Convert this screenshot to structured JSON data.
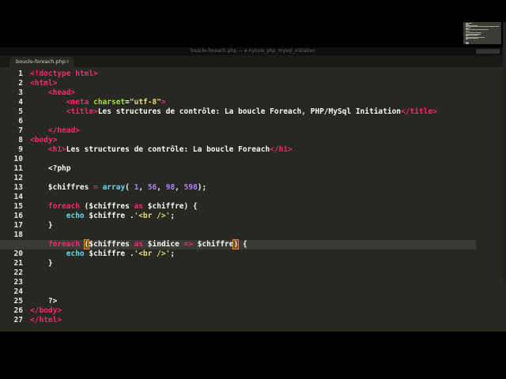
{
  "window_title": "boucle-foreach.php — e-nyture_php_mysql_initiation",
  "tab": {
    "label": "boucle-foreach.php",
    "close": "×"
  },
  "current_line": 19,
  "lines": [
    [
      {
        "t": "<!doctype html>",
        "c": "tg"
      }
    ],
    [
      {
        "t": "<html>",
        "c": "tg"
      }
    ],
    [
      {
        "t": "    "
      },
      {
        "t": "<head>",
        "c": "tg"
      }
    ],
    [
      {
        "t": "        "
      },
      {
        "t": "<meta ",
        "c": "tg"
      },
      {
        "t": "charset",
        "c": "at"
      },
      {
        "t": "="
      },
      {
        "t": "\"utf-8\"",
        "c": "st"
      },
      {
        "t": ">",
        "c": "tg"
      }
    ],
    [
      {
        "t": "        "
      },
      {
        "t": "<title>",
        "c": "tg"
      },
      {
        "t": "Les structures de contrôle: La boucle Foreach, PHP/MySql Initiation"
      },
      {
        "t": "</title>",
        "c": "tg"
      }
    ],
    [],
    [
      {
        "t": "    "
      },
      {
        "t": "</head>",
        "c": "tg"
      }
    ],
    [
      {
        "t": "<body>",
        "c": "tg"
      }
    ],
    [
      {
        "t": "    "
      },
      {
        "t": "<h1>",
        "c": "tg"
      },
      {
        "t": "Les structures de contrôle: La boucle Foreach"
      },
      {
        "t": "</h1>",
        "c": "tg"
      }
    ],
    [],
    [
      {
        "t": "    "
      },
      {
        "t": "<?php"
      }
    ],
    [],
    [
      {
        "t": "    "
      },
      {
        "t": "$chiffres ",
        "c": "vr"
      },
      {
        "t": "=",
        "c": "kw"
      },
      {
        "t": " "
      },
      {
        "t": "array",
        "c": "fn"
      },
      {
        "t": "( "
      },
      {
        "t": "1",
        "c": "nm"
      },
      {
        "t": ", "
      },
      {
        "t": "56",
        "c": "nm"
      },
      {
        "t": ", "
      },
      {
        "t": "98",
        "c": "nm"
      },
      {
        "t": ", "
      },
      {
        "t": "598",
        "c": "nm"
      },
      {
        "t": ");"
      }
    ],
    [],
    [
      {
        "t": "    "
      },
      {
        "t": "foreach",
        "c": "kw"
      },
      {
        "t": " ($chiffres "
      },
      {
        "t": "as",
        "c": "kw"
      },
      {
        "t": " $chiffre) {"
      }
    ],
    [
      {
        "t": "        "
      },
      {
        "t": "echo",
        "c": "fn"
      },
      {
        "t": " $chiffre ."
      },
      {
        "t": "'<br />'",
        "c": "st"
      },
      {
        "t": ";"
      }
    ],
    [
      {
        "t": "    }"
      }
    ],
    [],
    [
      {
        "t": "    "
      },
      {
        "t": "foreach",
        "c": "kw"
      },
      {
        "t": " "
      },
      {
        "t": "(",
        "c": "brk"
      },
      {
        "t": "$chiffres "
      },
      {
        "t": "as",
        "c": "kw"
      },
      {
        "t": " $indice "
      },
      {
        "t": "=>",
        "c": "kw"
      },
      {
        "t": " $chiffre"
      },
      {
        "t": ")",
        "c": "brk"
      },
      {
        "t": " {"
      }
    ],
    [
      {
        "t": "        "
      },
      {
        "t": "echo",
        "c": "fn"
      },
      {
        "t": " $chiffre ."
      },
      {
        "t": "'<br />'",
        "c": "st"
      },
      {
        "t": ";"
      }
    ],
    [
      {
        "t": "    }"
      }
    ],
    [],
    [],
    [],
    [
      {
        "t": "    "
      },
      {
        "t": "?>"
      }
    ],
    [
      {
        "t": "</body>",
        "c": "tg"
      }
    ],
    [
      {
        "t": "</html>",
        "c": "tg"
      }
    ]
  ]
}
